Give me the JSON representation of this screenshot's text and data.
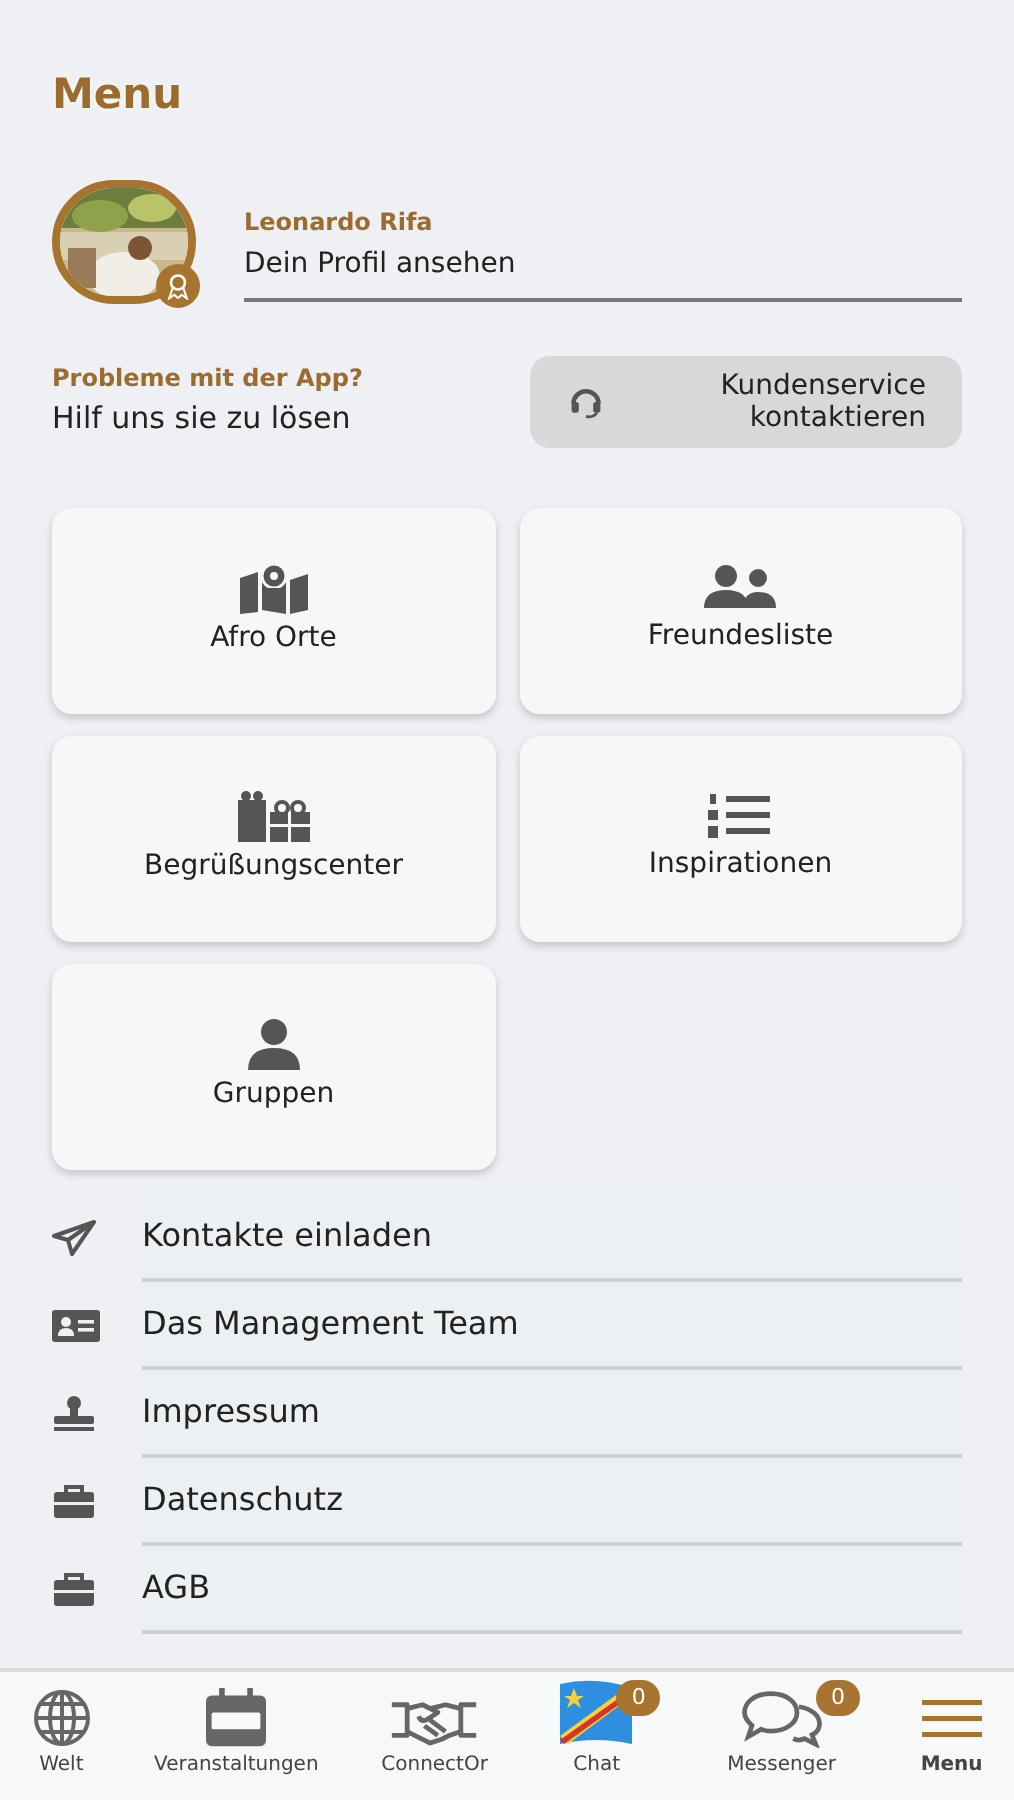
{
  "title": "Menu",
  "profile": {
    "name": "Leonardo Rifa",
    "link": "Dein Profil ansehen",
    "has_award": true
  },
  "support": {
    "heading": "Probleme mit der App?",
    "text": "Hilf uns sie zu lösen",
    "button": "Kundenservice kontaktieren"
  },
  "tiles": [
    {
      "label": "Afro Orte"
    },
    {
      "label": "Freundesliste"
    },
    {
      "label": "Begrüßungscenter"
    },
    {
      "label": "Inspirationen"
    },
    {
      "label": "Gruppen"
    }
  ],
  "list_items": [
    {
      "label": "Kontakte einladen"
    },
    {
      "label": "Das Management Team"
    },
    {
      "label": "Impressum"
    },
    {
      "label": "Datenschutz"
    },
    {
      "label": "AGB"
    }
  ],
  "tab_bar": [
    {
      "label": "Welt",
      "selected": false
    },
    {
      "label": "Veranstaltungen",
      "selected": false
    },
    {
      "label": "ConnectOr",
      "selected": false
    },
    {
      "label": "Chat",
      "selected": false,
      "badge": "0"
    },
    {
      "label": "Messenger",
      "selected": false,
      "badge": "0"
    },
    {
      "label": "Menu",
      "selected": true
    }
  ]
}
